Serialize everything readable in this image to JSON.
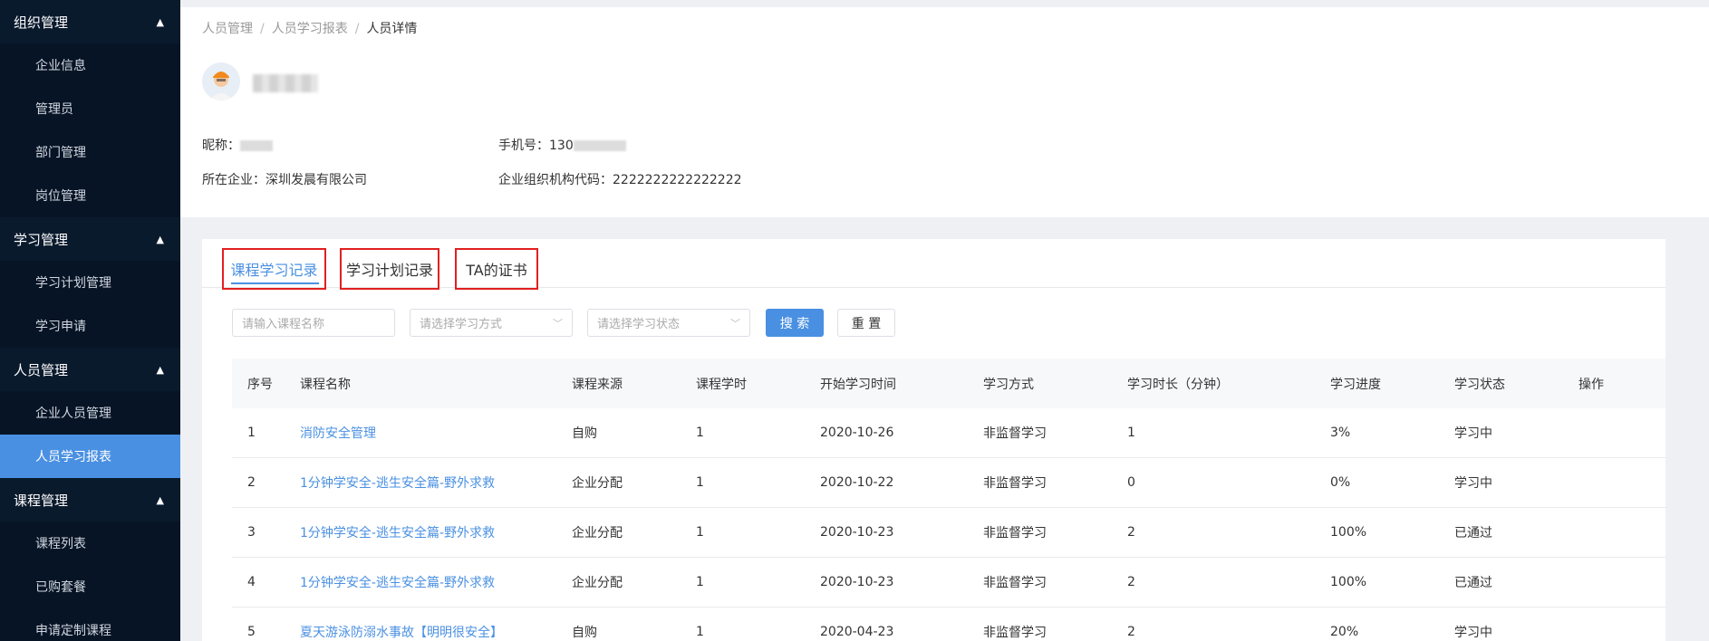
{
  "sidebar": {
    "groups": [
      {
        "label": "组织管理",
        "items": [
          "企业信息",
          "管理员",
          "部门管理",
          "岗位管理"
        ]
      },
      {
        "label": "学习管理",
        "items": [
          "学习计划管理",
          "学习申请"
        ]
      },
      {
        "label": "人员管理",
        "items": [
          "企业人员管理",
          "人员学习报表"
        ]
      },
      {
        "label": "课程管理",
        "items": [
          "课程列表",
          "已购套餐",
          "申请定制课程"
        ]
      }
    ],
    "active_item": "人员学习报表"
  },
  "breadcrumb": [
    "人员管理",
    "人员学习报表",
    "人员详情"
  ],
  "profile": {
    "nickname_label": "昵称：",
    "phone_label": "手机号：",
    "phone_visible": "130",
    "company_label": "所在企业：",
    "company_value": "深圳发晨有限公司",
    "org_code_label": "企业组织机构代码：",
    "org_code_value": "2222222222222222"
  },
  "tabs": [
    "课程学习记录",
    "学习计划记录",
    "TA的证书"
  ],
  "filters": {
    "course_name_placeholder": "请输入课程名称",
    "study_method_placeholder": "请选择学习方式",
    "study_status_placeholder": "请选择学习状态",
    "search_label": "搜 索",
    "reset_label": "重 置"
  },
  "table": {
    "columns": [
      "序号",
      "课程名称",
      "课程来源",
      "课程学时",
      "开始学习时间",
      "学习方式",
      "学习时长（分钟）",
      "学习进度",
      "学习状态",
      "操作"
    ],
    "rows": [
      [
        "1",
        "消防安全管理",
        "自购",
        "1",
        "2020-10-26",
        "非监督学习",
        "1",
        "3%",
        "学习中",
        ""
      ],
      [
        "2",
        "1分钟学安全-逃生安全篇-野外求救",
        "企业分配",
        "1",
        "2020-10-22",
        "非监督学习",
        "0",
        "0%",
        "学习中",
        ""
      ],
      [
        "3",
        "1分钟学安全-逃生安全篇-野外求救",
        "企业分配",
        "1",
        "2020-10-23",
        "非监督学习",
        "2",
        "100%",
        "已通过",
        ""
      ],
      [
        "4",
        "1分钟学安全-逃生安全篇-野外求救",
        "企业分配",
        "1",
        "2020-10-23",
        "非监督学习",
        "2",
        "100%",
        "已通过",
        ""
      ],
      [
        "5",
        "夏天游泳防溺水事故【明明很安全】",
        "自购",
        "1",
        "2020-04-23",
        "非监督学习",
        "2",
        "20%",
        "学习中",
        ""
      ]
    ]
  },
  "colors": {
    "accent": "#4a90e2",
    "sidebar_bg": "#0b1d33",
    "highlight_border": "#e02020"
  }
}
